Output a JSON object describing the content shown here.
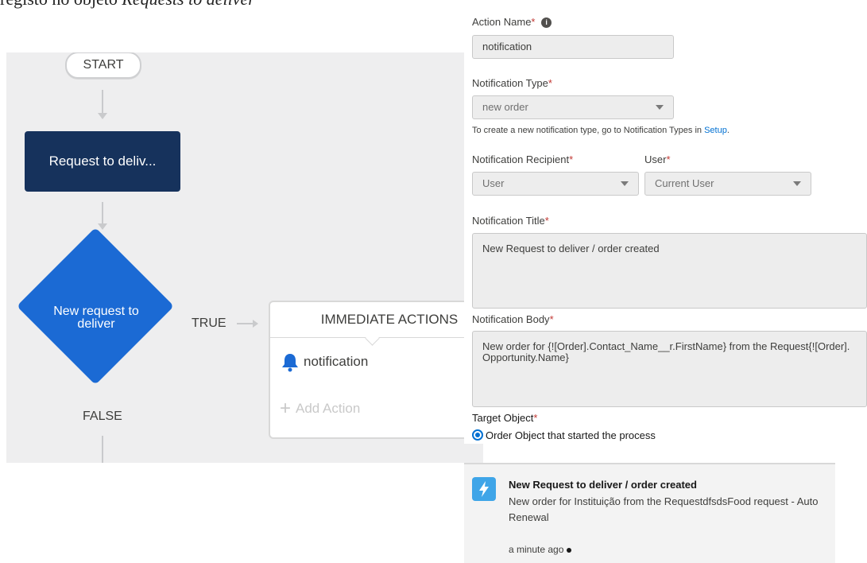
{
  "doc_fragment": {
    "text_plain": "registo no objeto ",
    "text_italic": "Requests to deliver"
  },
  "process": {
    "start_label": "START",
    "criteria_label": "Request to deliv...",
    "decision_label": "New request to deliver",
    "true_label": "TRUE",
    "false_label": "FALSE",
    "immediate_actions_title": "IMMEDIATE ACTIONS",
    "action_item_label": "notification",
    "action_item_icon": "bell-icon",
    "add_action_label": "Add Action",
    "colors": {
      "criteria_node": "#16325c",
      "decision_node": "#1b6ad4",
      "canvas": "#eeeeef"
    }
  },
  "form": {
    "action_name_label": "Action Name",
    "action_name_value": "notification",
    "notification_type_label": "Notification Type",
    "notification_type_value": "new order",
    "notification_type_hint_prefix": "To create a new notification type, go to Notification Types in ",
    "notification_type_hint_link": "Setup",
    "notification_type_hint_suffix": ".",
    "recipient_label": "Notification Recipient",
    "recipient_value": "User",
    "user_label": "User",
    "user_value": "Current User",
    "title_label": "Notification Title",
    "title_value": "New Request to deliver / order created",
    "body_label": "Notification Body",
    "body_value": "New order for {![Order].Contact_Name__r.FirstName} from the Request{![Order].Opportunity.Name}",
    "target_object_label": "Target Object",
    "target_object_option": "Order Object that started the process",
    "required_marker": "*"
  },
  "notification_card": {
    "title": "New Request to deliver / order created",
    "body": "New order for Instituição from the RequestdfsdsFood request - Auto Renewal",
    "time": "a minute ago",
    "icon": "lightning-icon",
    "icon_color": "#3fa5e8"
  }
}
